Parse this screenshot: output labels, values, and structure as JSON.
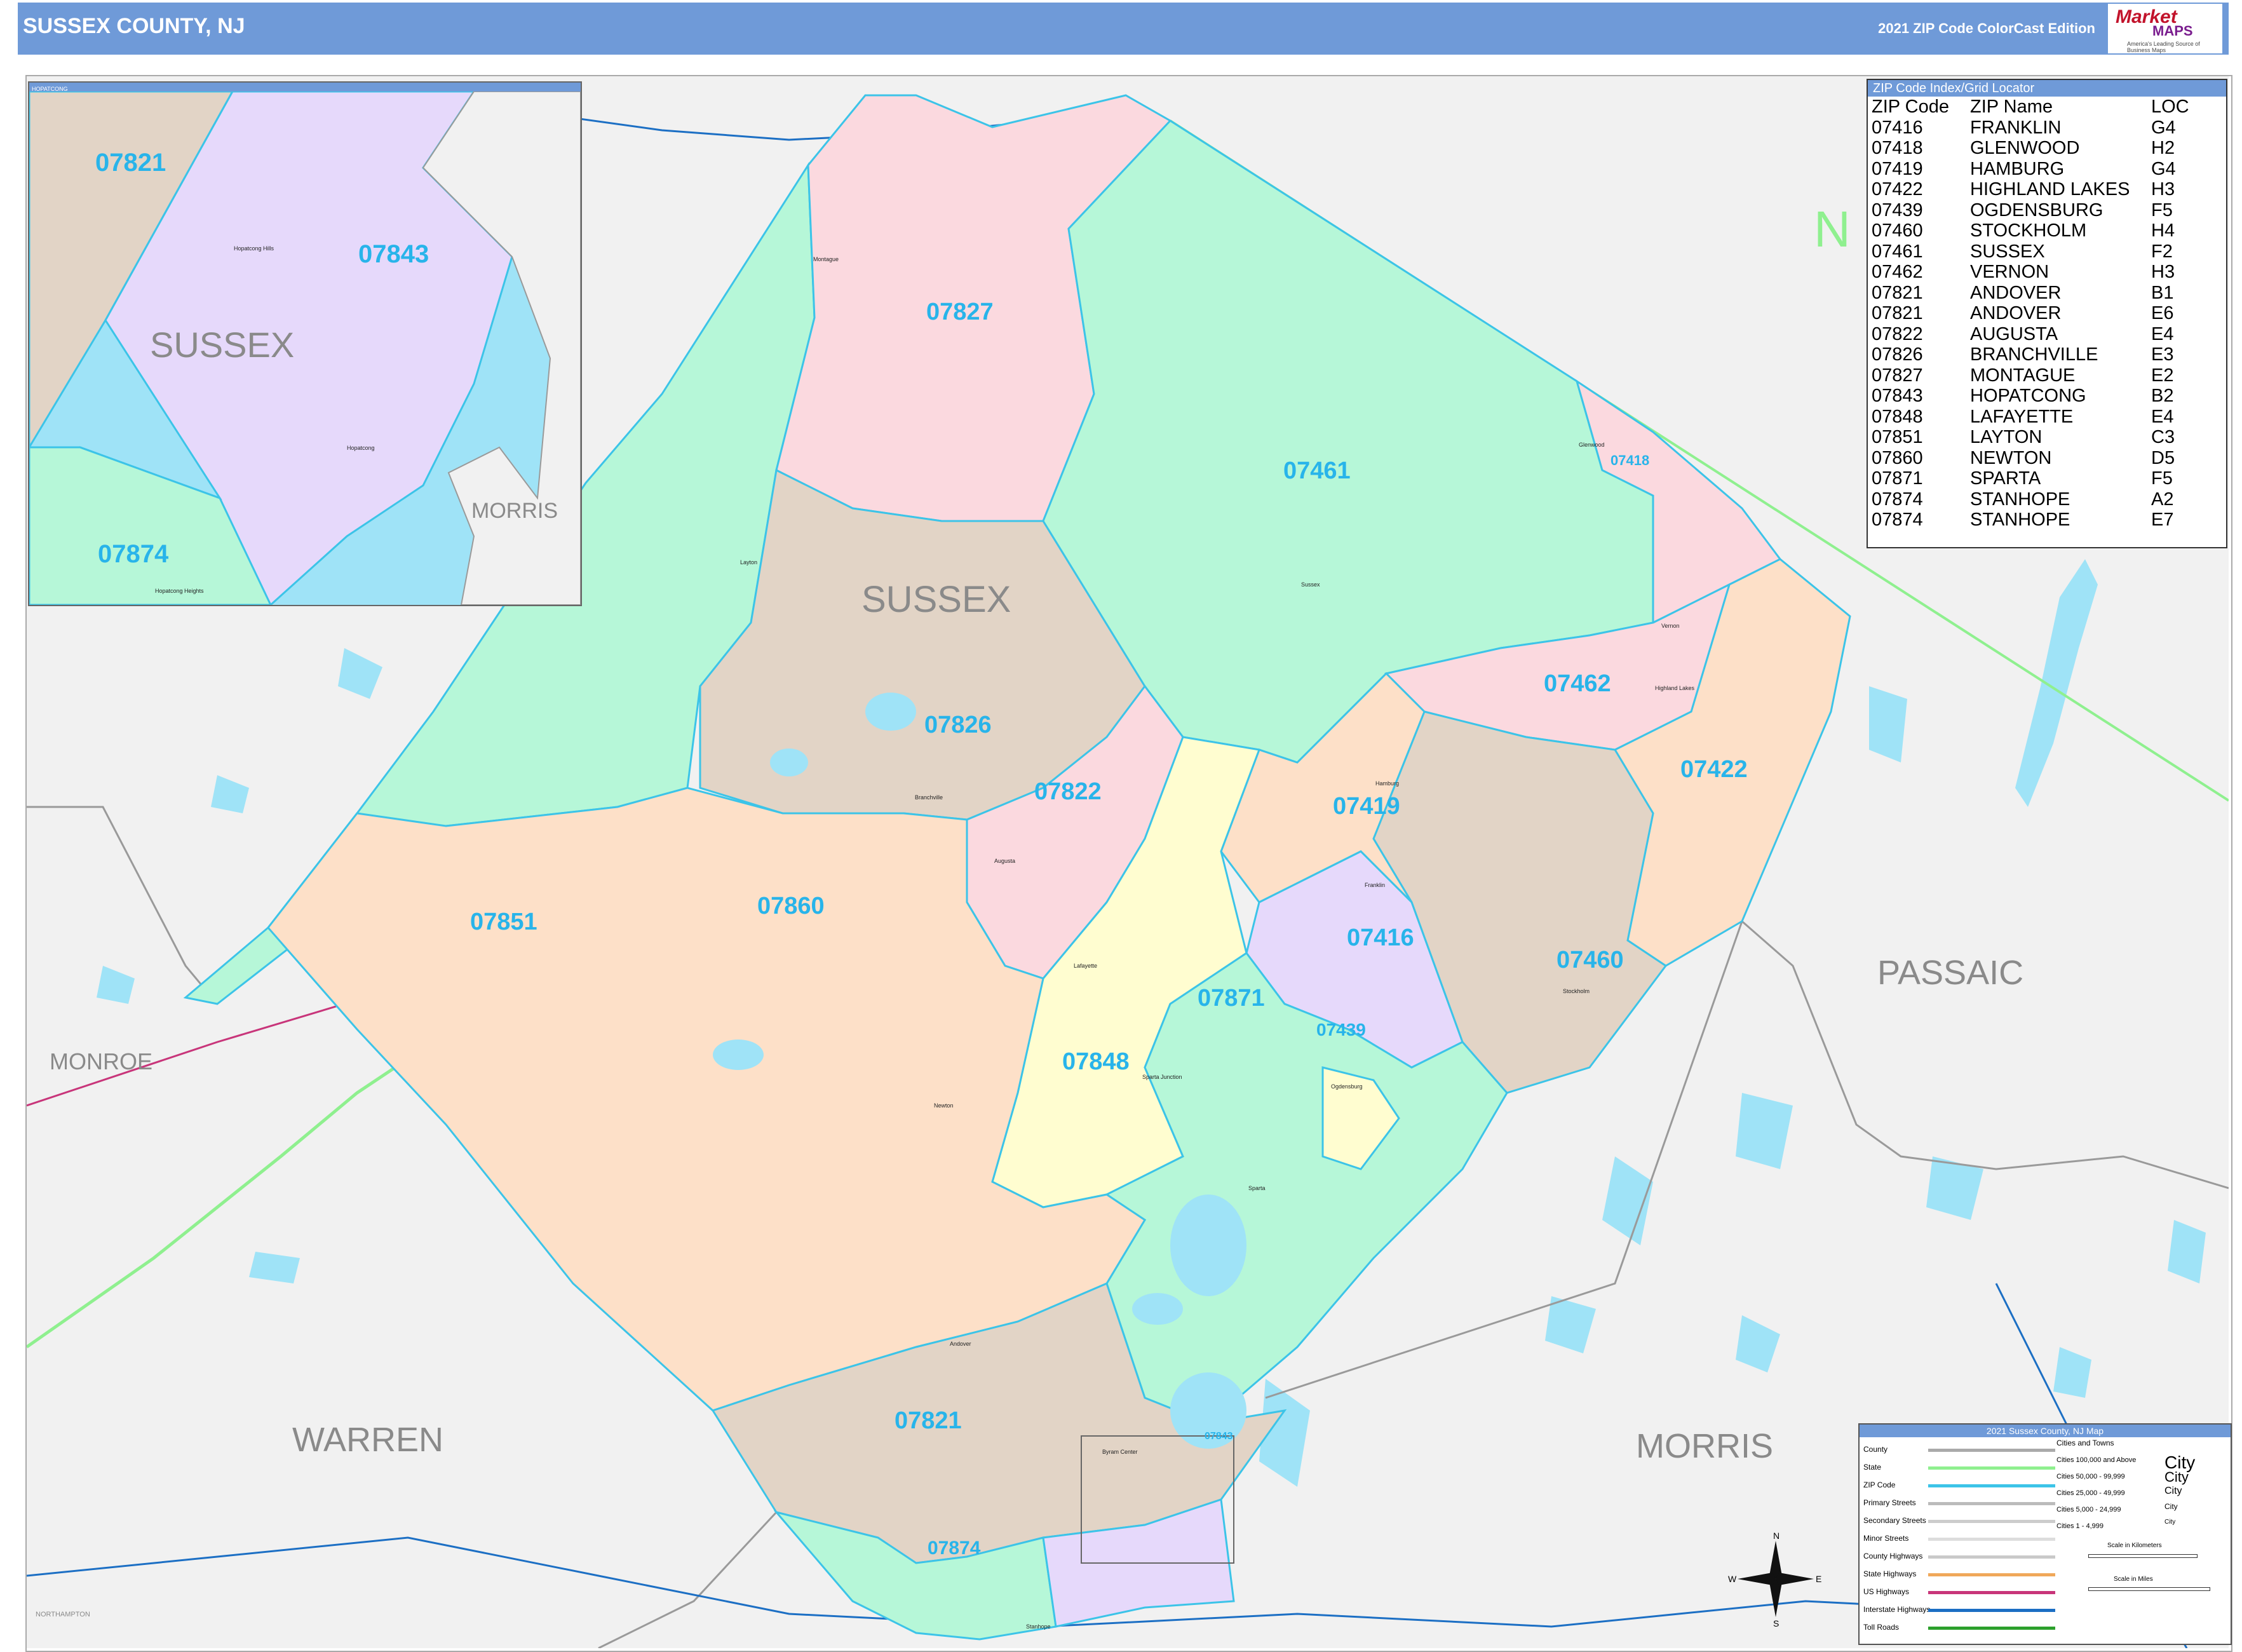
{
  "header": {
    "title": "SUSSEX COUNTY, NJ",
    "edition": "2021 ZIP Code ColorCast Edition"
  },
  "logo": {
    "brand_top": "Market",
    "brand_bottom": "MAPS",
    "tagline": "America's Leading Source of Business Maps"
  },
  "index": {
    "title": "ZIP Code Index/Grid Locator",
    "columns": [
      "ZIP Code",
      "ZIP Name",
      "LOC"
    ],
    "rows": [
      [
        "07416",
        "FRANKLIN",
        "G4"
      ],
      [
        "07418",
        "GLENWOOD",
        "H2"
      ],
      [
        "07419",
        "HAMBURG",
        "G4"
      ],
      [
        "07422",
        "HIGHLAND LAKES",
        "H3"
      ],
      [
        "07439",
        "OGDENSBURG",
        "F5"
      ],
      [
        "07460",
        "STOCKHOLM",
        "H4"
      ],
      [
        "07461",
        "SUSSEX",
        "F2"
      ],
      [
        "07462",
        "VERNON",
        "H3"
      ],
      [
        "07821",
        "ANDOVER",
        "B1"
      ],
      [
        "07821",
        "ANDOVER",
        "E6"
      ],
      [
        "07822",
        "AUGUSTA",
        "E4"
      ],
      [
        "07826",
        "BRANCHVILLE",
        "E3"
      ],
      [
        "07827",
        "MONTAGUE",
        "E2"
      ],
      [
        "07843",
        "HOPATCONG",
        "B2"
      ],
      [
        "07848",
        "LAFAYETTE",
        "E4"
      ],
      [
        "07851",
        "LAYTON",
        "C3"
      ],
      [
        "07860",
        "NEWTON",
        "D5"
      ],
      [
        "07871",
        "SPARTA",
        "F5"
      ],
      [
        "07874",
        "STANHOPE",
        "A2"
      ],
      [
        "07874",
        "STANHOPE",
        "E7"
      ]
    ]
  },
  "counties": {
    "sussex": "SUSSEX",
    "passaic": "PASSAIC",
    "morris": "MORRIS",
    "warren": "WARREN",
    "monroe": "MONROE",
    "inset_sussex": "SUSSEX",
    "inset_morris": "MORRIS",
    "ny_partial": "N",
    "northampton": "NORTHAMPTON"
  },
  "zips": {
    "z07827": "07827",
    "z07461": "07461",
    "z07418": "07418",
    "z07826": "07826",
    "z07822": "07822",
    "z07462": "07462",
    "z07422": "07422",
    "z07419": "07419",
    "z07860": "07860",
    "z07851": "07851",
    "z07416": "07416",
    "z07460": "07460",
    "z07871": "07871",
    "z07439": "07439",
    "z07848": "07848",
    "z07821": "07821",
    "z07874": "07874",
    "z07843": "07843",
    "inset_07821": "07821",
    "inset_07843": "07843",
    "inset_07874": "07874"
  },
  "places": {
    "p1": "Montague",
    "p2": "Layton",
    "p3": "Branchville",
    "p4": "Newton",
    "p5": "Sparta",
    "p6": "Franklin",
    "p7": "Hamburg",
    "p8": "Vernon",
    "p9": "Sussex",
    "p10": "Andover",
    "p11": "Stanhope",
    "p12": "Lafayette",
    "p13": "Augusta",
    "p14": "Ogdensburg",
    "p15": "Stockholm",
    "p16": "Highland Lakes",
    "p17": "Hopatcong",
    "p18": "Hopatcong Hills",
    "p19": "Hopatcong Heights",
    "p20": "Glenwood",
    "p21": "Byram Center",
    "p22": "Sparta Junction"
  },
  "inset": {
    "title": "HOPATCONG"
  },
  "legend": {
    "title": "2021 Sussex County, NJ Map",
    "items": [
      "County",
      "State",
      "ZIP Code",
      "Primary Streets",
      "Secondary Streets",
      "Minor Streets",
      "County Highways",
      "State Highways",
      "US Highways",
      "Interstate Highways",
      "Toll Roads"
    ],
    "cities_title": "Cities and Towns",
    "cities": [
      "Cities 100,000 and Above",
      "Cities 50,000 - 99,999",
      "Cities 25,000 - 49,999",
      "Cities 5,000 - 24,999",
      "Cities 1 - 4,999"
    ],
    "city_word": "City",
    "scale_km": "Scale in Kilometers",
    "scale_mi": "Scale in Miles"
  },
  "compass": {
    "n": "N",
    "s": "S",
    "e": "E",
    "w": "W"
  },
  "colors": {
    "header": "#6f9ad8",
    "zip_label": "#28b4ea",
    "boundary": "#3cc4e8",
    "water": "#9fe3f7"
  }
}
